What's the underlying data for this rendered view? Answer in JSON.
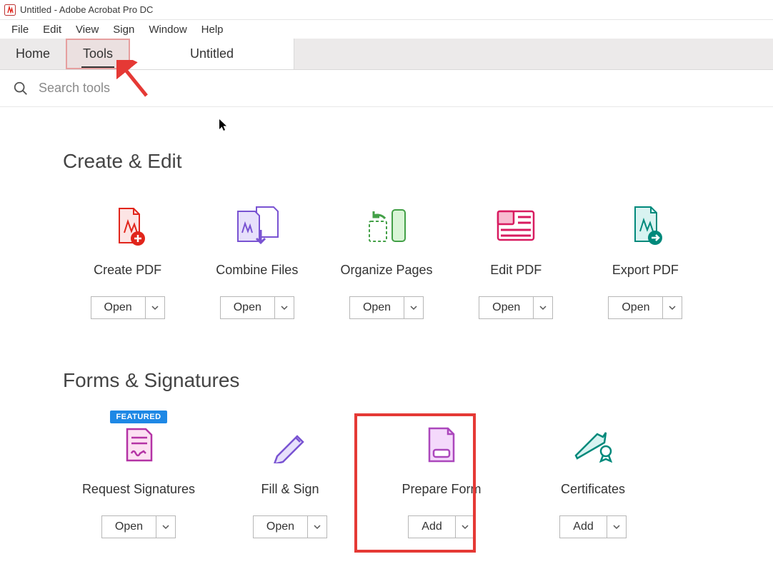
{
  "window": {
    "title": "Untitled - Adobe Acrobat Pro DC"
  },
  "menus": {
    "file": "File",
    "edit": "Edit",
    "view": "View",
    "sign": "Sign",
    "window": "Window",
    "help": "Help"
  },
  "tabs": {
    "home": "Home",
    "tools": "Tools",
    "doc": "Untitled"
  },
  "search": {
    "placeholder": "Search tools"
  },
  "sections": {
    "create_edit": {
      "title": "Create & Edit"
    },
    "forms": {
      "title": "Forms & Signatures"
    }
  },
  "tools": {
    "create_pdf": {
      "label": "Create PDF",
      "action": "Open"
    },
    "combine": {
      "label": "Combine Files",
      "action": "Open"
    },
    "organize": {
      "label": "Organize Pages",
      "action": "Open"
    },
    "edit_pdf": {
      "label": "Edit PDF",
      "action": "Open"
    },
    "export": {
      "label": "Export PDF",
      "action": "Open"
    },
    "request_sig": {
      "label": "Request Signatures",
      "action": "Open",
      "badge": "FEATURED"
    },
    "fill_sign": {
      "label": "Fill & Sign",
      "action": "Open"
    },
    "prepare_form": {
      "label": "Prepare Form",
      "action": "Add"
    },
    "certificates": {
      "label": "Certificates",
      "action": "Add"
    }
  }
}
